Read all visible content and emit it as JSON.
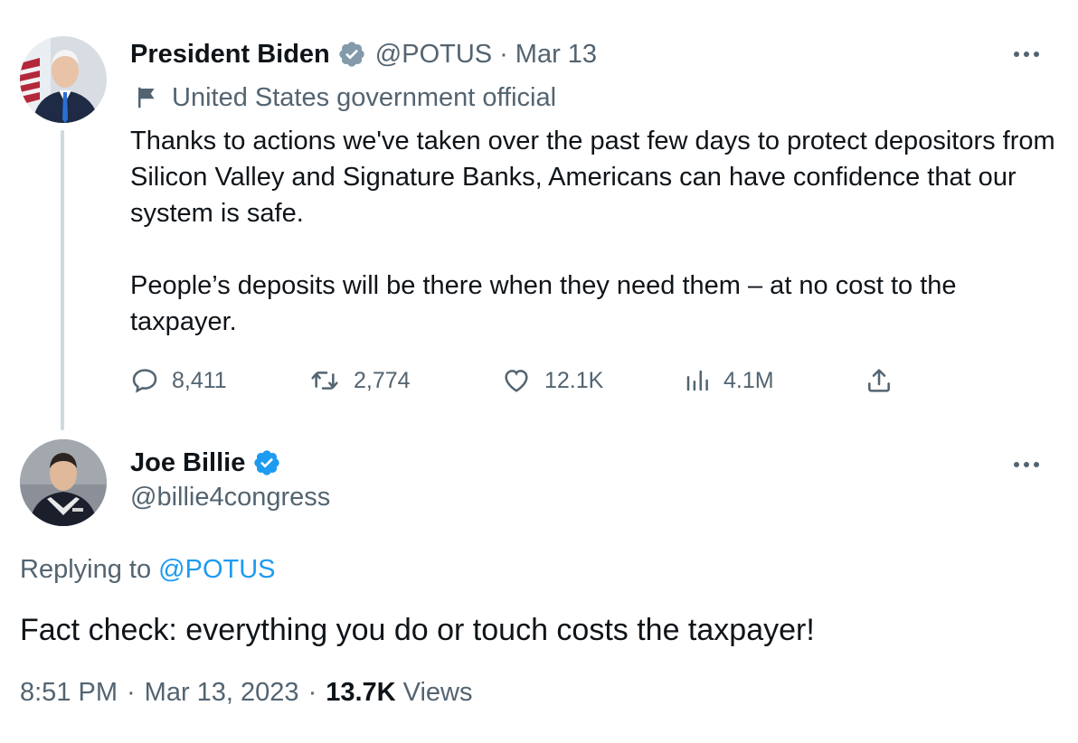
{
  "tweet": {
    "author_name": "President Biden",
    "handle": "@POTUS",
    "separator": "·",
    "date": "Mar 13",
    "label": "United States government official",
    "text_p1": "Thanks to actions we've taken over the past few days to protect depositors from Silicon Valley and Signature Banks, Americans can have confidence that our system is safe.",
    "text_p2": "People’s deposits will be there when they need them – at no cost to the taxpayer.",
    "stats": {
      "replies": "8,411",
      "retweets": "2,774",
      "likes": "12.1K",
      "views": "4.1M"
    },
    "verified_color": "#829aab"
  },
  "reply": {
    "author_name": "Joe Billie",
    "handle": "@billie4congress",
    "replying_prefix": "Replying to",
    "replying_to": "@POTUS",
    "text": "Fact check: everything you do or touch costs the taxpayer!",
    "time": "8:51 PM",
    "separator": "·",
    "date": "Mar 13, 2023",
    "views_count": "13.7K",
    "views_label": "Views",
    "verified_color": "#1d9bf0"
  },
  "icons": {
    "reply": "speech-bubble-icon",
    "retweet": "retweet-icon",
    "like": "heart-icon",
    "views": "bar-chart-icon",
    "share": "share-upload-icon",
    "more": "more-dots-icon",
    "label": "flag-icon"
  },
  "colors": {
    "text": "#0f1419",
    "secondary": "#536471",
    "link": "#1d9bf0",
    "thread_line": "#cfd9de"
  }
}
